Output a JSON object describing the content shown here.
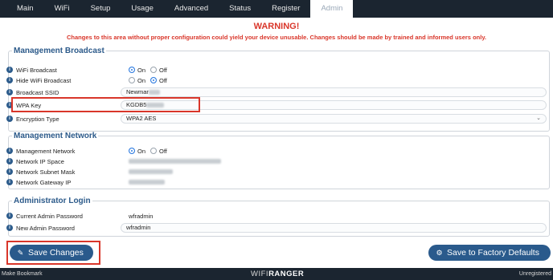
{
  "tabs": [
    {
      "label": "Main"
    },
    {
      "label": "WiFi"
    },
    {
      "label": "Setup"
    },
    {
      "label": "Usage"
    },
    {
      "label": "Advanced"
    },
    {
      "label": "Status"
    },
    {
      "label": "Register"
    },
    {
      "label": "Admin"
    }
  ],
  "active_tab": "Admin",
  "warning": {
    "title": "WARNING!",
    "text": "Changes to this area without proper configuration could yield your device unusable. Changes should be made by trained and informed users only."
  },
  "broadcast": {
    "legend": "Management Broadcast",
    "wifi_broadcast": {
      "label": "WiFi Broadcast",
      "on": "On",
      "off": "Off",
      "selected": "On"
    },
    "hide_wifi": {
      "label": "Hide WiFi Broadcast",
      "on": "On",
      "off": "Off",
      "selected": "Off"
    },
    "ssid": {
      "label": "Broadcast SSID",
      "value": "Newmar"
    },
    "wpa": {
      "label": "WPA Key",
      "value": "KGDB5"
    },
    "encryption": {
      "label": "Encryption Type",
      "value": "WPA2 AES"
    }
  },
  "network": {
    "legend": "Management Network",
    "mgmt": {
      "label": "Management Network",
      "on": "On",
      "off": "Off",
      "selected": "On"
    },
    "ip_space": {
      "label": "Network IP Space"
    },
    "subnet": {
      "label": "Network Subnet Mask"
    },
    "gateway": {
      "label": "Network Gateway IP"
    }
  },
  "admin": {
    "legend": "Administrator Login",
    "current": {
      "label": "Current Admin Password",
      "value": "wfradmin"
    },
    "new": {
      "label": "New Admin Password",
      "value": "wfradmin"
    }
  },
  "buttons": {
    "save": "Save Changes",
    "factory": "Save to Factory Defaults"
  },
  "footer": {
    "left": "Make Bookmark",
    "brand_a": "WIFI",
    "brand_b": "RANGER",
    "right": "Unregistered"
  },
  "colors": {
    "accent": "#2a5a8c",
    "warning": "#d9362a",
    "bar": "#1b2530"
  }
}
